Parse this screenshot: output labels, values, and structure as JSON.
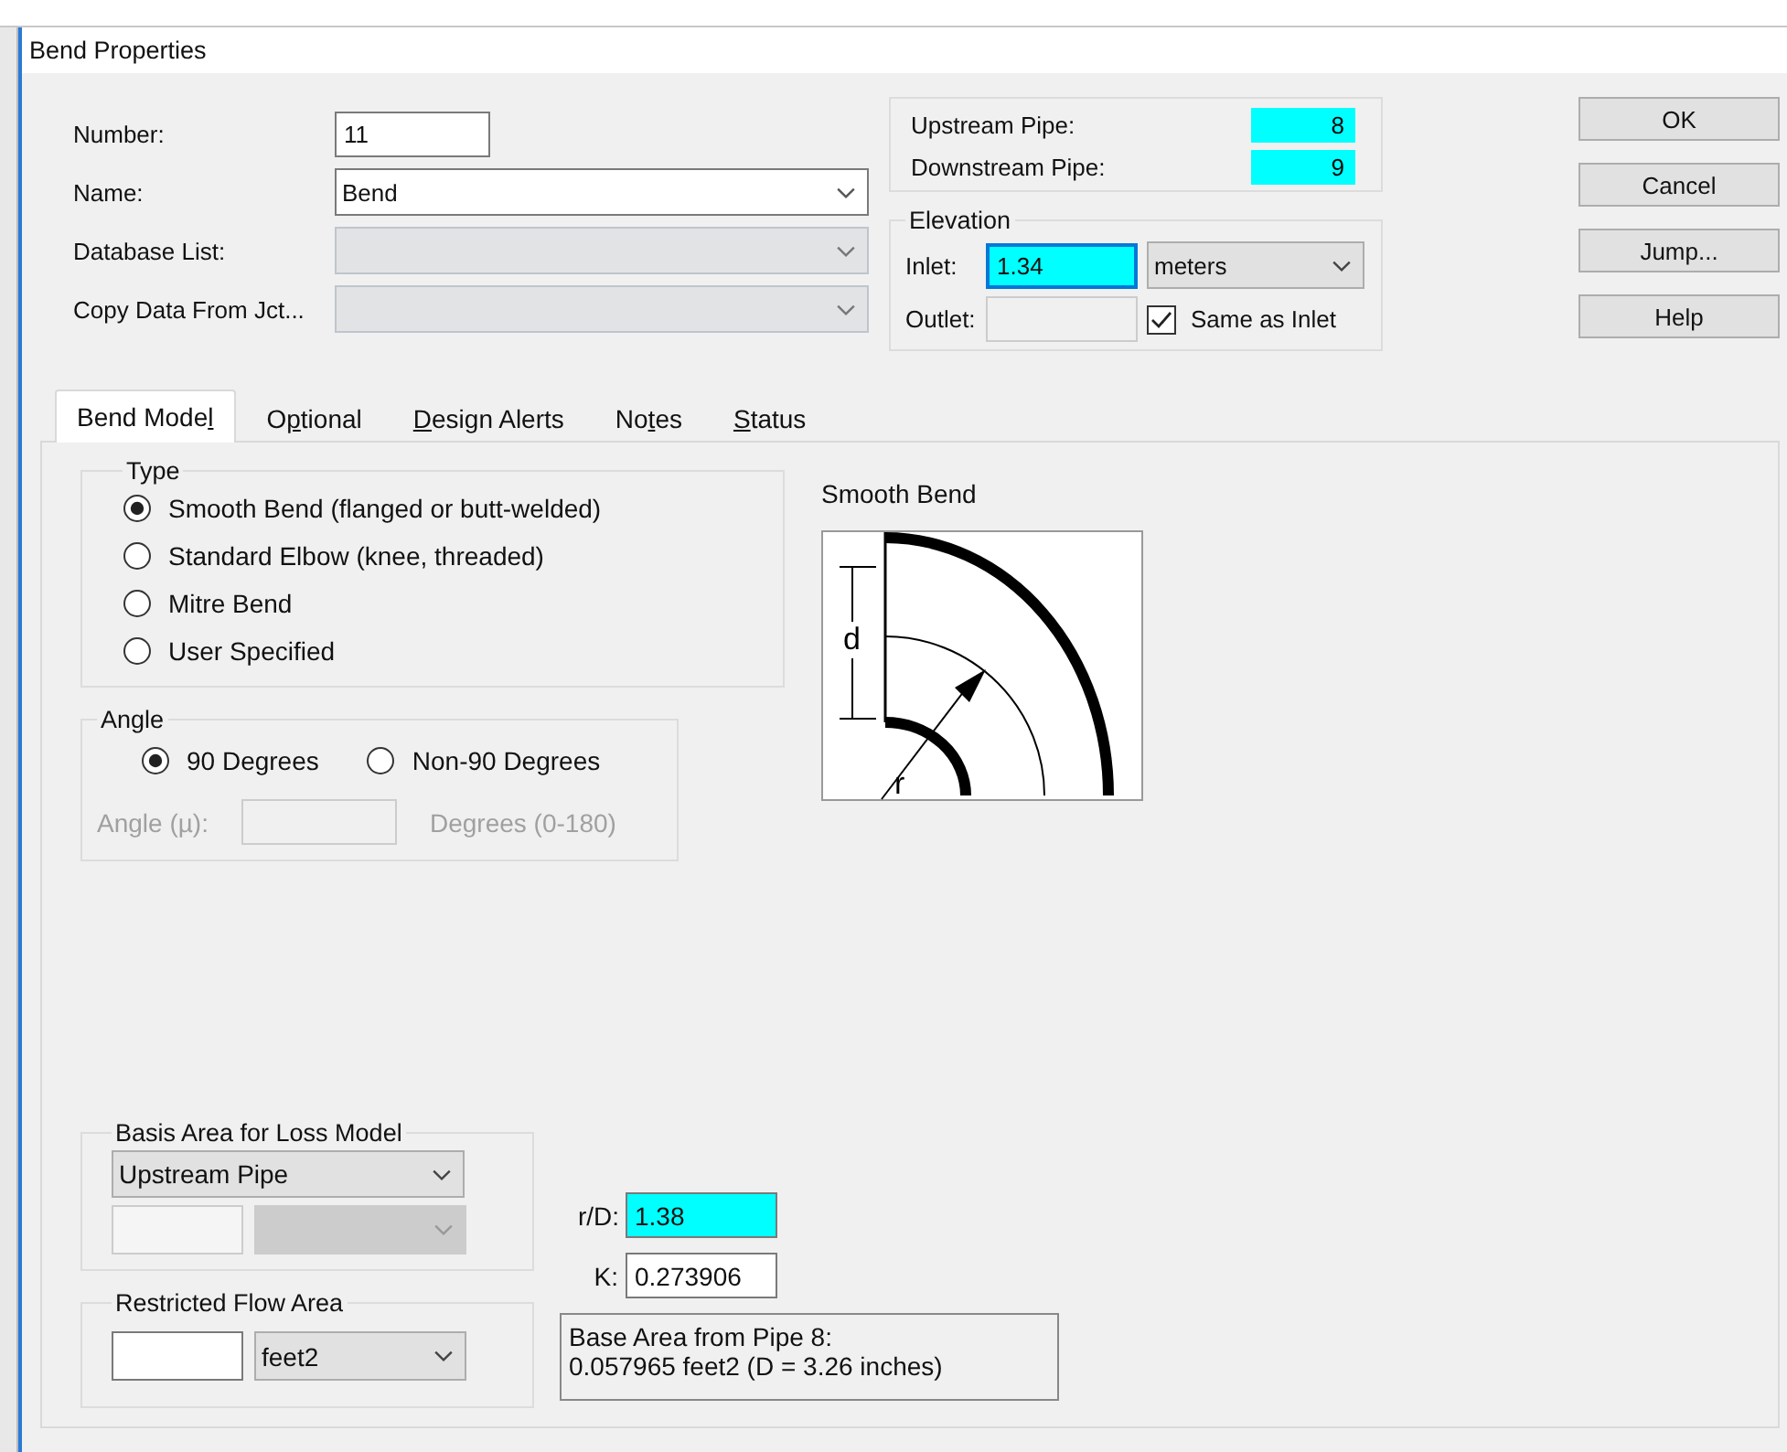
{
  "window": {
    "title": "Bend Properties"
  },
  "general": {
    "number_label": "Number:",
    "number": "11",
    "name_label": "Name:",
    "name": "Bend",
    "database_label": "Database List:",
    "database_disabled": true,
    "copy_label": "Copy Data From Jct...",
    "copy_disabled": true
  },
  "pipes": [
    {
      "label": "Upstream Pipe:",
      "value": "8",
      "highlighted": true
    },
    {
      "label": "Downstream Pipe:",
      "value": "9",
      "highlighted": true
    }
  ],
  "elevation": {
    "title": "Elevation",
    "inlet_label": "Inlet:",
    "inlet": "1.34",
    "inlet_highlighted": true,
    "inlet_focused": true,
    "unit": "meters",
    "outlet_label": "Outlet:",
    "outlet_disabled": true,
    "same_label": "Same as Inlet",
    "same_checked": true
  },
  "buttons": [
    "OK",
    "Cancel",
    "Jump...",
    "Help"
  ],
  "tabs": [
    {
      "before": "Bend Mode",
      "key": "l",
      "selected": true
    },
    {
      "before": "O",
      "key": "p",
      "after": "tional",
      "selected": false
    },
    {
      "key": "D",
      "after": "esign Alerts",
      "selected": false
    },
    {
      "before": "No",
      "key": "t",
      "after": "es",
      "selected": false
    },
    {
      "key": "S",
      "after": "tatus",
      "selected": false
    }
  ],
  "type": {
    "title": "Type",
    "options": [
      {
        "label": "Smooth Bend (flanged or butt-welded)",
        "selected": true
      },
      {
        "label": "Standard Elbow (knee, threaded)",
        "selected": false
      },
      {
        "label": "Mitre Bend",
        "selected": false
      },
      {
        "label": "User Specified",
        "selected": false
      }
    ]
  },
  "angle": {
    "title": "Angle",
    "options": [
      {
        "label": "90 Degrees",
        "selected": true
      },
      {
        "label": "Non-90 Degrees",
        "selected": false
      }
    ],
    "field_label": "Angle (µ):",
    "field_disabled": true,
    "units": "Degrees (0-180)"
  },
  "diagram": {
    "title": "Smooth Bend",
    "d_label": "d",
    "r_label": "r"
  },
  "basis_area": {
    "title": "Basis Area for Loss Model",
    "value": "Upstream Pipe",
    "second_row_disabled": true
  },
  "restricted_flow": {
    "title": "Restricted Flow Area",
    "unit": "feet2"
  },
  "coefficients": [
    {
      "label": "r/D:",
      "value": "1.38",
      "highlighted": true
    },
    {
      "label": "K:",
      "value": "0.273906",
      "highlighted": false
    }
  ],
  "info": [
    "Base Area from Pipe 8:",
    "0.057965 feet2 (D = 3.26 inches)"
  ]
}
